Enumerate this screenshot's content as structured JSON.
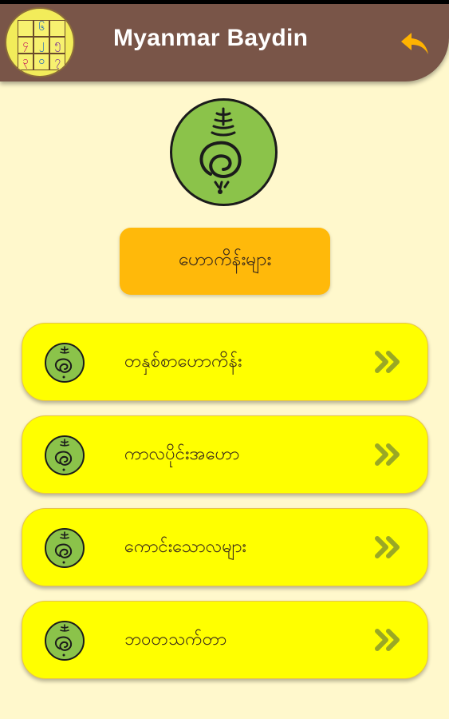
{
  "header": {
    "title": "Myanmar Baydin",
    "logo_cells": [
      "",
      "၆",
      "",
      "၄",
      "၂",
      "၅",
      "၃",
      "၀",
      "၇"
    ],
    "back_icon": "reply-arrow-icon"
  },
  "main": {
    "hero_icon": "astrology-symbol-icon",
    "section_label": "ဟောကိန်းများ",
    "items": [
      {
        "label": "တနှစ်စာဟောကိန်း",
        "icon": "astrology-symbol-icon",
        "arrow": "double-chevron-right-icon"
      },
      {
        "label": "ကာလပိုင်းအဟော",
        "icon": "astrology-symbol-icon",
        "arrow": "double-chevron-right-icon"
      },
      {
        "label": "ကောင်းသောလများ",
        "icon": "astrology-symbol-icon",
        "arrow": "double-chevron-right-icon"
      },
      {
        "label": "ဘဝတသက်တာ",
        "icon": "astrology-symbol-icon",
        "arrow": "double-chevron-right-icon"
      }
    ]
  },
  "colors": {
    "background": "#fff8cc",
    "app_bar": "#795548",
    "accent_orange": "#ffb90a",
    "item_yellow": "#ffff00",
    "icon_green": "#8bc34a",
    "chevron_green": "#9aa825"
  }
}
